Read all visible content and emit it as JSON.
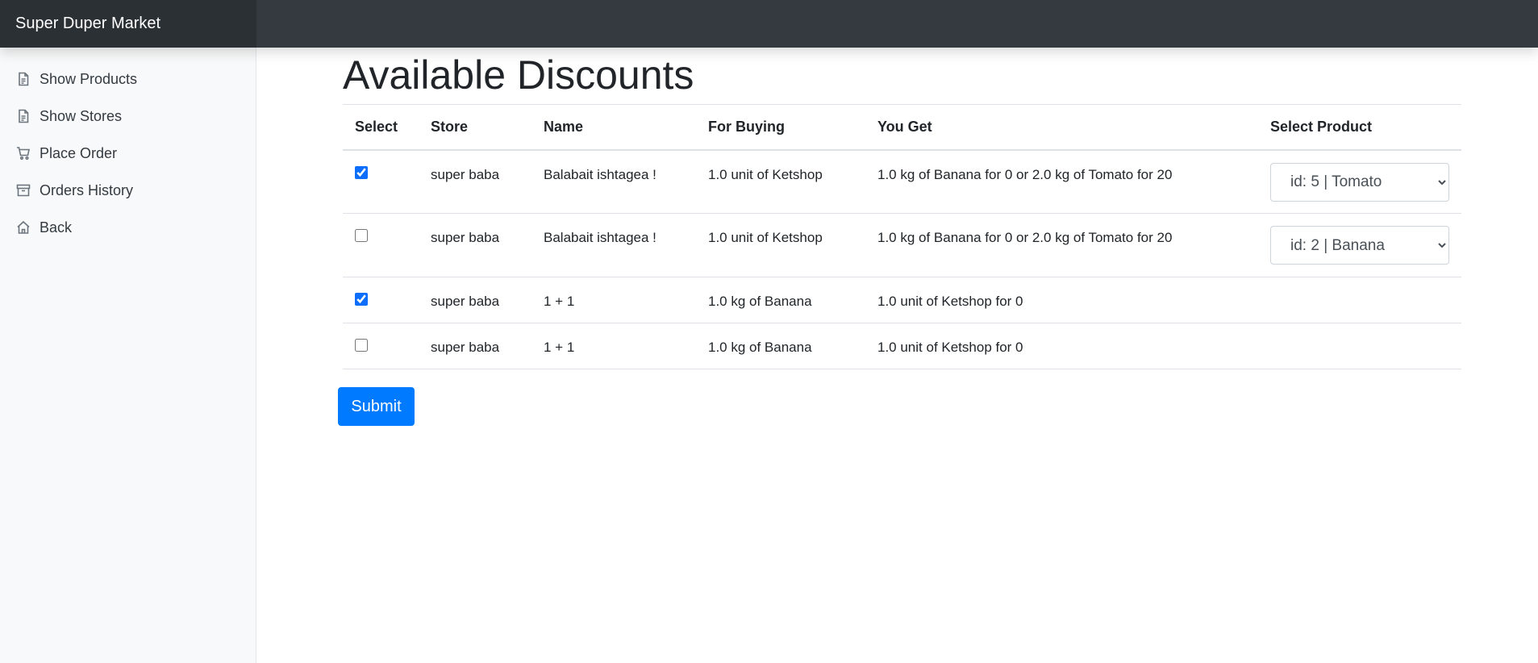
{
  "app": {
    "title": "Super Duper Market"
  },
  "sidebar": {
    "items": [
      {
        "label": "Show Products",
        "icon": "file-icon"
      },
      {
        "label": "Show Stores",
        "icon": "file-icon"
      },
      {
        "label": "Place Order",
        "icon": "cart-icon"
      },
      {
        "label": "Orders History",
        "icon": "archive-icon"
      },
      {
        "label": "Back",
        "icon": "home-icon"
      }
    ]
  },
  "page": {
    "title": "Available Discounts"
  },
  "table": {
    "headers": [
      "Select",
      "Store",
      "Name",
      "For Buying",
      "You Get",
      "Select Product"
    ],
    "rows": [
      {
        "checked": true,
        "store": "super baba",
        "name": "Balabait ishtagea !",
        "for_buying": "1.0 unit of Ketshop",
        "you_get": "1.0 kg of Banana for 0 or 2.0 kg of Tomato for 20",
        "select_product": "id: 5 | Tomato"
      },
      {
        "checked": false,
        "store": "super baba",
        "name": "Balabait ishtagea !",
        "for_buying": "1.0 unit of Ketshop",
        "you_get": "1.0 kg of Banana for 0 or 2.0 kg of Tomato for 20",
        "select_product": "id: 2 | Banana"
      },
      {
        "checked": true,
        "store": "super baba",
        "name": "1 + 1",
        "for_buying": "1.0 kg of Banana",
        "you_get": "1.0 unit of Ketshop for 0",
        "select_product": null
      },
      {
        "checked": false,
        "store": "super baba",
        "name": "1 + 1",
        "for_buying": "1.0 kg of Banana",
        "you_get": "1.0 unit of Ketshop for 0",
        "select_product": null
      }
    ]
  },
  "submit_label": "Submit",
  "colors": {
    "topbar": "#343a40",
    "primary": "#007bff"
  }
}
